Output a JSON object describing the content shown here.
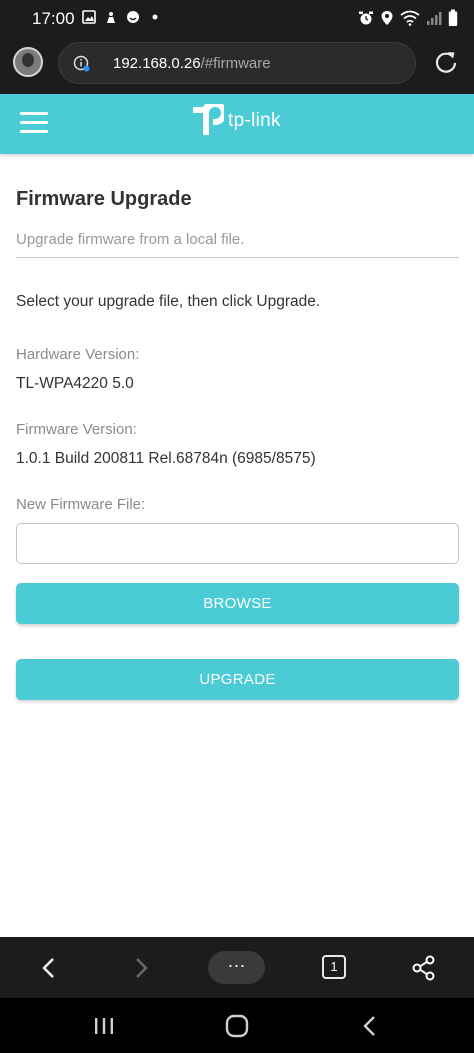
{
  "status_bar": {
    "time": "17:00"
  },
  "address_bar": {
    "host": "192.168.0.26",
    "path": "/#firmware"
  },
  "header": {
    "brand": "tp-link"
  },
  "page": {
    "title": "Firmware Upgrade",
    "subtitle": "Upgrade firmware from a local file.",
    "instruction": "Select your upgrade file, then click Upgrade.",
    "hardware_label": "Hardware Version:",
    "hardware_value": "TL-WPA4220 5.0",
    "firmware_label": "Firmware Version:",
    "firmware_value": "1.0.1 Build 200811 Rel.68784n (6985/8575)",
    "file_label": "New Firmware File:",
    "file_value": "",
    "browse_label": "BROWSE",
    "upgrade_label": "UPGRADE"
  },
  "browser_toolbar": {
    "menu_label": "···",
    "tab_count": "1"
  },
  "colors": {
    "accent": "#4acbd6",
    "dark_chrome": "#1c1c1e"
  }
}
